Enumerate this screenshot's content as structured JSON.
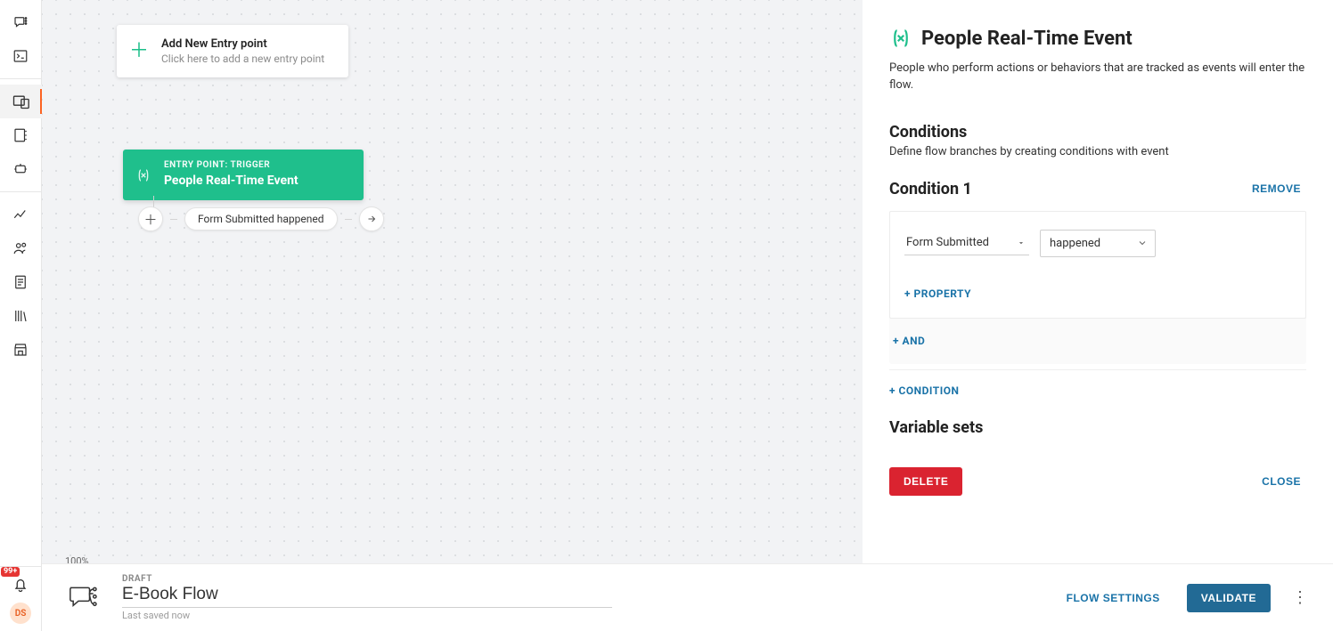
{
  "rail": {
    "notif_badge": "99+",
    "avatar_initials": "DS"
  },
  "canvas": {
    "add_entry": {
      "title": "Add New Entry point",
      "subtitle": "Click here to add a new entry point"
    },
    "trigger_node": {
      "label_over": "ENTRY POINT: TRIGGER",
      "label_main": "People Real-Time Event"
    },
    "condition_chip": "Form Submitted happened",
    "zoom": "100%"
  },
  "panel": {
    "title": "People Real-Time Event",
    "description": "People who perform actions or behaviors that are tracked as events will enter the flow.",
    "conditions_heading": "Conditions",
    "conditions_sub": "Define flow branches by creating conditions with event",
    "condition_1_label": "Condition 1",
    "remove_label": "REMOVE",
    "event_select": "Form Submitted",
    "op_select": "happened",
    "add_property_label": "+ PROPERTY",
    "add_and_label": "+ AND",
    "add_condition_label": "+ CONDITION",
    "var_sets_heading": "Variable sets",
    "delete_label": "DELETE",
    "close_label": "CLOSE"
  },
  "footer": {
    "status": "DRAFT",
    "flow_name": "E-Book Flow",
    "saved_text": "Last saved now",
    "flow_settings_label": "FLOW SETTINGS",
    "validate_label": "VALIDATE"
  }
}
